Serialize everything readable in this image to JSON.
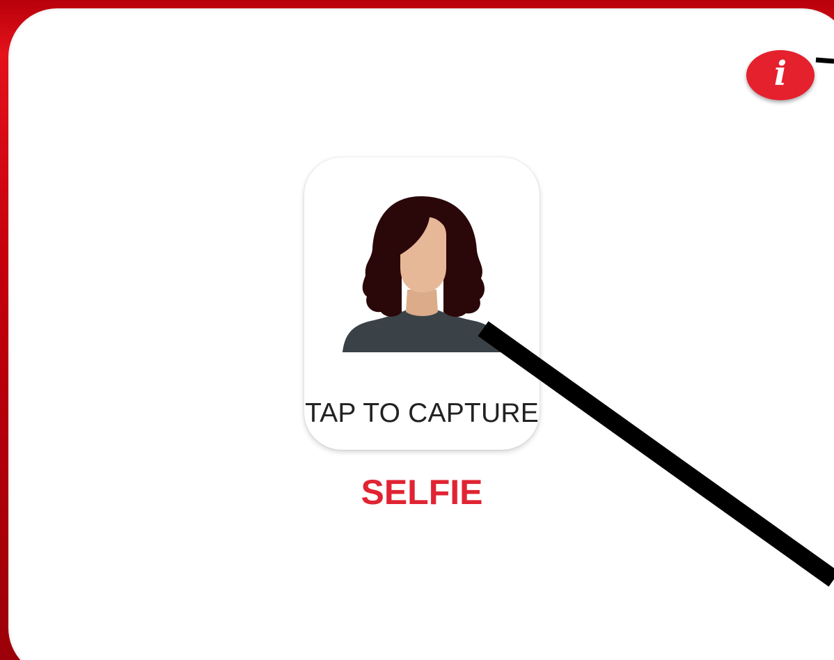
{
  "info_button": {
    "glyph": "i",
    "icon": "info-icon"
  },
  "capture": {
    "label": "TAP TO CAPTURE",
    "avatar_icon": "woman-avatar-icon"
  },
  "title": "SELFIE",
  "colors": {
    "accent_red": "#e02433",
    "frame_red": "#d10a14",
    "card_bg": "#ffffff",
    "hair": "#2a0709",
    "skin": "#e6b898",
    "shirt": "#3b4247"
  }
}
